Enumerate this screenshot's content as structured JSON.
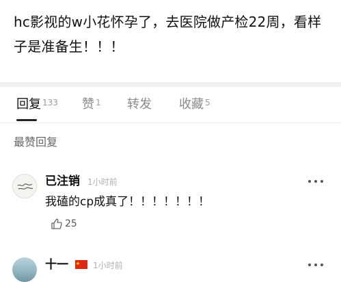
{
  "post": {
    "text": "hc影视的w小花怀孕了，去医院做产检22周，看样子是准备生！！！"
  },
  "tabs": [
    {
      "label": "回复",
      "count": "133"
    },
    {
      "label": "赞",
      "count": "1"
    },
    {
      "label": "转发",
      "count": ""
    },
    {
      "label": "收藏",
      "count": "5"
    }
  ],
  "section": {
    "title": "最赞回复"
  },
  "comments": [
    {
      "username": "已注销",
      "time": "1小时前",
      "text": "我磕的cp成真了！！！！！！！",
      "likes": "25",
      "avatar_icon": "scribble-avatar"
    },
    {
      "username": "十一",
      "time": "1小时前",
      "text": "",
      "flag_icon": "red-flag-icon"
    }
  ],
  "colors": {
    "text": "#111111",
    "muted": "#8a8a8a",
    "timestamp": "#b0b0b0",
    "divider": "#f2f2f2",
    "flag": "#de2910"
  }
}
